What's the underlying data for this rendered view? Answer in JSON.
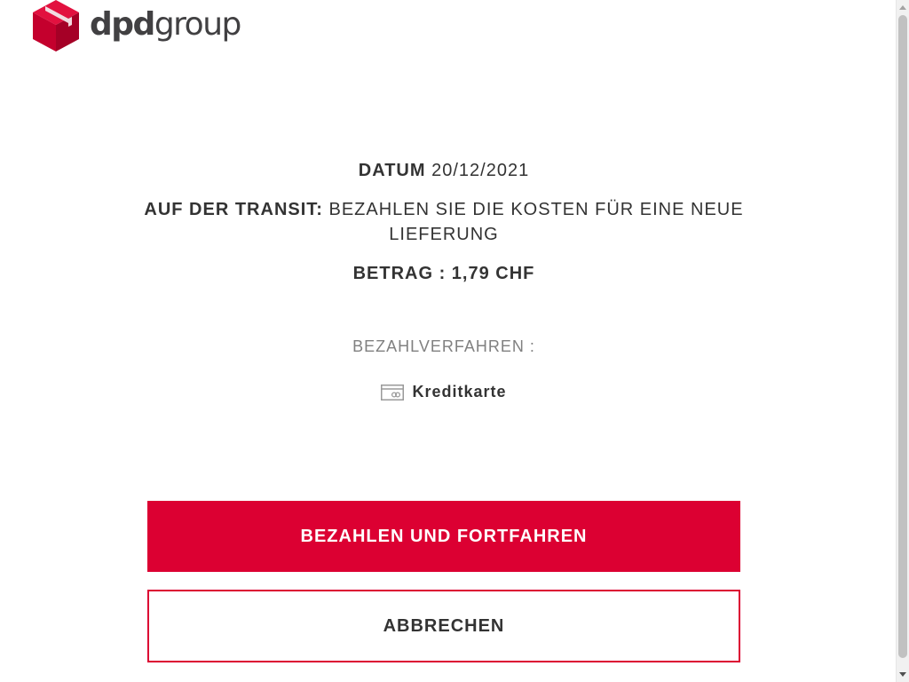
{
  "header": {
    "logo_dpd": "dpd",
    "logo_group": "group",
    "logo_icon": "dpd-cube-icon"
  },
  "details": {
    "date_label": "DATUM",
    "date_value": "20/12/2021",
    "transit_label": "AUF DER TRANSIT:",
    "transit_text": "BEZAHLEN SIE DIE KOSTEN FÜR EINE NEUE LIEFERUNG",
    "amount_text": "BETRAG : 1,79 CHF"
  },
  "payment": {
    "method_label": "BEZAHLVERFAHREN :",
    "method_name": "Kreditkarte",
    "method_icon": "credit-card-icon"
  },
  "actions": {
    "pay_label": "BEZAHLEN UND FORTFAHREN",
    "cancel_label": "ABBRECHEN"
  },
  "colors": {
    "brand_red": "#dc0032",
    "text": "#333333",
    "muted": "#808080"
  }
}
